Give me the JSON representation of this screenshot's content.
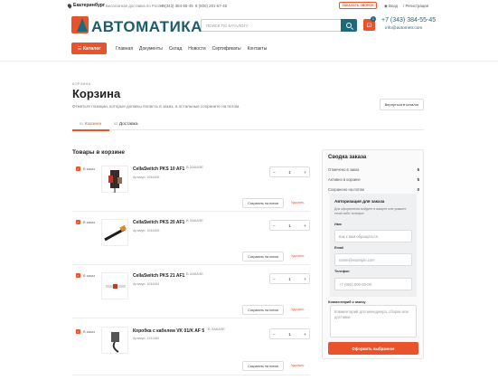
{
  "topbar": {
    "city": "Екатеринбург",
    "shipping": "Бесплатная доставка по России:",
    "phone1": "+7 (343) 384-55-45",
    "phone2": "8 (800) 201-67-45",
    "callback": "ЗАКАЗАТЬ ЗВОНОК",
    "login": "Вход",
    "register": "Регистрация"
  },
  "header": {
    "logo": "АВТОМАТИКА",
    "search_placeholder": "ПОИСК ПО КАТАЛОГУ",
    "cart_count": "1",
    "phone": "+7 (343) 384-55-45",
    "email": "info@avtometr.com"
  },
  "nav": {
    "catalog": "Каталог",
    "items": [
      "Главная",
      "Документы",
      "Склад",
      "Новости",
      "Сертификаты",
      "Контакты"
    ]
  },
  "page": {
    "breadcrumb": "КОРЗИНА",
    "title": "Корзина",
    "subtitle": "Отметьте позиции, которые должны попасть в заказ, а остальные сохраните на потом.",
    "back": "Вернуться в каталог",
    "tabs": [
      {
        "num": "01",
        "label": "Корзина"
      },
      {
        "num": "02",
        "label": "Доставка"
      }
    ]
  },
  "cart": {
    "title": "Товары в корзине",
    "in_order_label": "В заказ",
    "article_prefix": "Артикул:",
    "order_badge": "В ЗАКАЗЕ",
    "save_label": "Сохранить на потом",
    "delete_label": "Удалить",
    "items": [
      {
        "name": "CellaSwitch PKS 10 AF1",
        "article": "1044456",
        "qty": "1"
      },
      {
        "name": "CellaSwitch PKS 20 AF1",
        "article": "1044455",
        "qty": "1"
      },
      {
        "name": "CellaSwitch PKS 21 AF1",
        "article": "1044454",
        "qty": "1"
      },
      {
        "name": "Коробка с кабелем VK 01/K AF 5",
        "article": "1131480",
        "qty": "1"
      }
    ]
  },
  "summary": {
    "title": "Сводка заказа",
    "rows": [
      {
        "label": "Отмечено в заказ",
        "value": "5"
      },
      {
        "label": "Активно в корзине",
        "value": "5"
      },
      {
        "label": "Сохранено на потом",
        "value": "0"
      }
    ],
    "auth_title": "Авторизация для заказа",
    "auth_desc": "Для оформления войдите в аккаунт или укажите email либо телефон.",
    "name_label": "Имя",
    "name_placeholder": "Как к вам обращаться",
    "email_label": "Email",
    "email_placeholder": "name@example.com",
    "phone_label": "Телефон",
    "phone_placeholder": "+7 (900) 000-00-00",
    "comment_label": "Комментарий к заказу",
    "comment_placeholder": "Комментарий для менеджера, сборки или доставки",
    "submit": "Оформить выбранное"
  },
  "colors": {
    "accent": "#e8532b",
    "brand": "#1d6a7a"
  }
}
